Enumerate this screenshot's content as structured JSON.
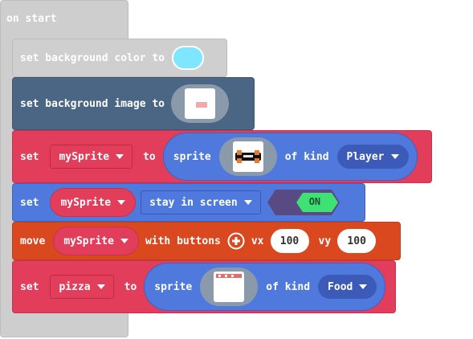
{
  "on_start": {
    "label": "on start"
  },
  "set_bg_color": {
    "label": "set background color to",
    "color": "#7ee7ff"
  },
  "set_bg_image": {
    "label": "set background image to"
  },
  "set_my_sprite": {
    "set_label": "set",
    "var": "mySprite",
    "to_label": "to",
    "sprite_label": "sprite",
    "of_kind_label": "of kind",
    "kind": "Player"
  },
  "stay_in_screen": {
    "set_label": "set",
    "var": "mySprite",
    "property": "stay in screen",
    "toggle": "ON"
  },
  "move": {
    "label": "move",
    "var": "mySprite",
    "with_buttons_label": "with buttons",
    "vx_label": "vx",
    "vx": "100",
    "vy_label": "vy",
    "vy": "100"
  },
  "set_pizza": {
    "set_label": "set",
    "var": "pizza",
    "to_label": "to",
    "sprite_label": "sprite",
    "of_kind_label": "of kind",
    "kind": "Food"
  },
  "colors": {
    "hat": "#cecece",
    "bg_block": "#cfcfcf",
    "scene_block": "#4b6584",
    "sprites": "#e23d5b",
    "controller": "#d9481f",
    "props": "#4f79dd",
    "kind_dd": "#3c5bb8",
    "toggle_on": "#3ee174"
  }
}
